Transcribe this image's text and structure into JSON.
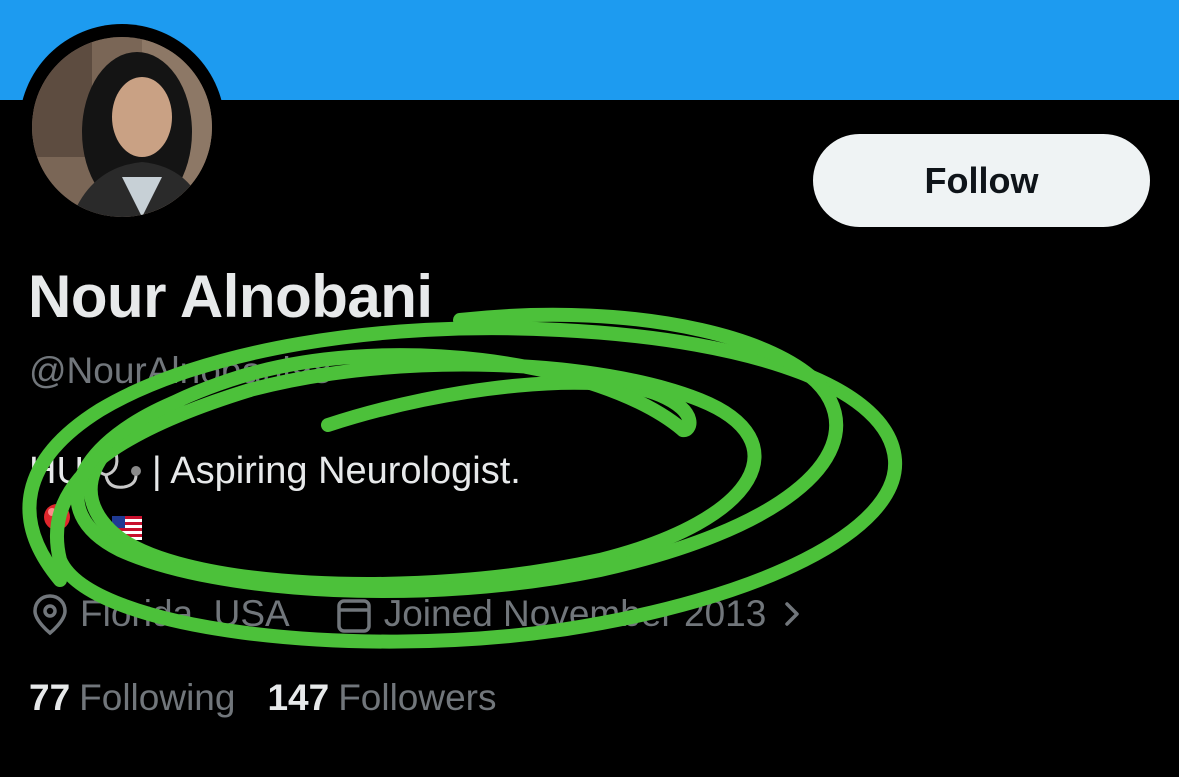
{
  "profile": {
    "display_name": "Nour Alnobani",
    "handle": "@NourAlnobani98",
    "bio_prefix": "HU",
    "bio_text": "| Aspiring Neurologist.",
    "bio_emojis": [
      "round-pushpin-emoji",
      "us-flag-emoji"
    ],
    "location": "Florida, USA",
    "joined": "Joined November 2013",
    "following_count": "77",
    "following_label": "Following",
    "followers_count": "147",
    "followers_label": "Followers"
  },
  "actions": {
    "follow_label": "Follow"
  },
  "icons": {
    "location": "location-pin-icon",
    "calendar": "calendar-icon",
    "chevron": "chevron-right-icon",
    "stethoscope": "stethoscope-emoji"
  },
  "colors": {
    "banner": "#1d9bf0",
    "background": "#000000",
    "primary_text": "#e7e9ea",
    "secondary_text": "#71767b",
    "follow_button_bg": "#eff3f4",
    "annotation": "#4cc13a"
  }
}
